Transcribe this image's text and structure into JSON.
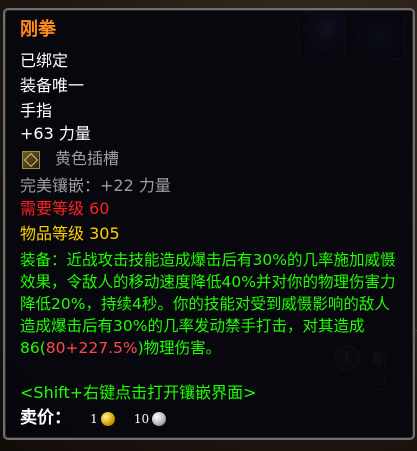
{
  "item": {
    "name": "刚拳",
    "binding": "已绑定",
    "unique": "装备唯一",
    "slot": "手指",
    "stat": "+63 力量",
    "socket": "黄色插槽",
    "socket_bonus": "完美镶嵌：+22 力量",
    "required_level_label": "需要等级",
    "required_level": "60",
    "item_level_label": "物品等级",
    "item_level": "305",
    "effect_part1": "装备：近战攻击技能造成爆击后有30%的几率施加威慑效果，令敌人的移动速度降低40%并对你的物理伤害力降低20%，持续4秒。你的技能对受到威慑影响的敌人造成爆击后有30%的几率发动禁手打击，对其造成86(",
    "effect_formula": "80+227.5%",
    "effect_part2": ")物理伤害。",
    "hint": "<Shift+右键点击打开镶嵌界面>",
    "sell_label": "卖价：",
    "sell_gold": "1",
    "sell_silver": "10"
  },
  "background": {
    "side_text_1": "断",
    "side_text_2": "-已",
    "side_badge": "1"
  },
  "colors": {
    "legendary": "#ff8a1a",
    "effect": "#1eff00",
    "requirement": "#ff2020",
    "item_level": "#ffd100"
  }
}
